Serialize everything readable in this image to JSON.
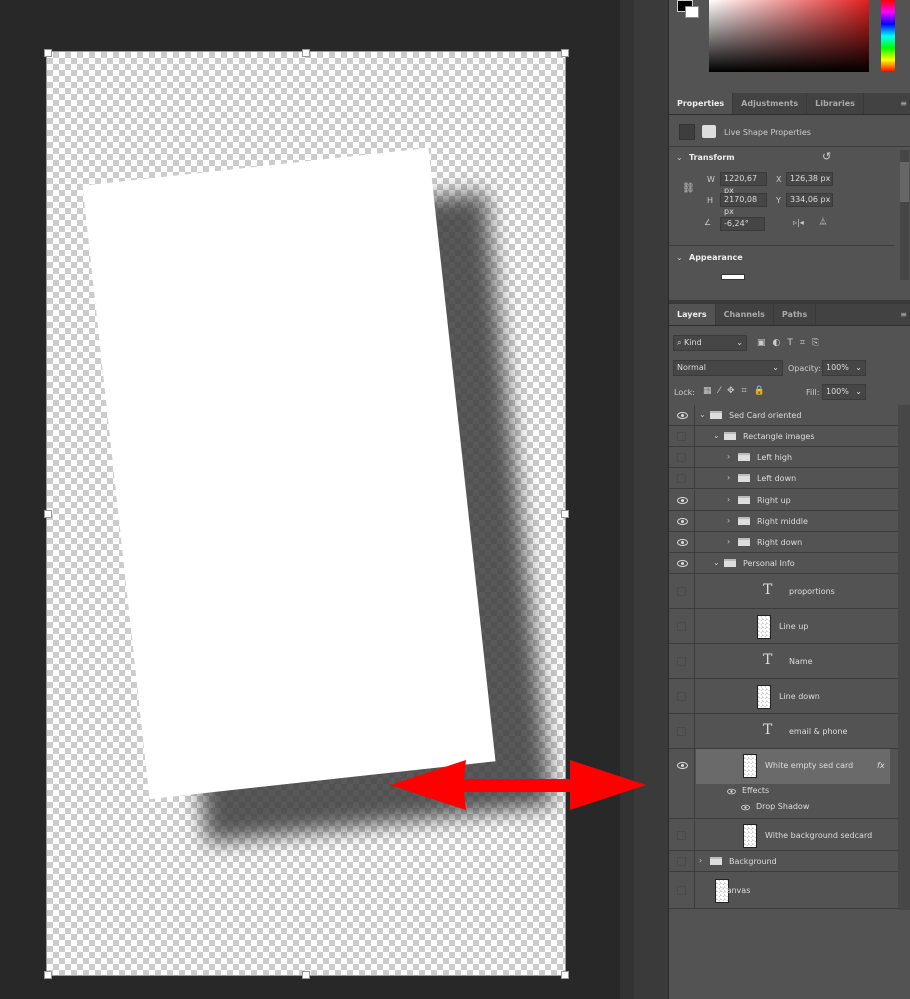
{
  "properties": {
    "tabs": [
      "Properties",
      "Adjustments",
      "Libraries"
    ],
    "subtitle": "Live Shape Properties",
    "transform_label": "Transform",
    "w_label": "W",
    "w": "1220,67 px",
    "x_label": "X",
    "x": "126,38 px",
    "h_label": "H",
    "h": "2170,08 px",
    "y_label": "Y",
    "y": "334,06 px",
    "angle": "-6,24°",
    "appearance_label": "Appearance"
  },
  "layers_panel": {
    "tabs": [
      "Layers",
      "Channels",
      "Paths"
    ],
    "filter": "Kind",
    "blend": "Normal",
    "opacity_label": "Opacity:",
    "opacity": "100%",
    "lock_label": "Lock:",
    "fill_label": "Fill:",
    "fill": "100%"
  },
  "layers": [
    {
      "name": "Sed Card oriented",
      "visible": true
    },
    {
      "name": "Rectangle images",
      "visible": false
    },
    {
      "name": "Left high",
      "visible": false
    },
    {
      "name": "Left down",
      "visible": false
    },
    {
      "name": "Right up",
      "visible": true
    },
    {
      "name": "Right middle",
      "visible": true
    },
    {
      "name": "Right down",
      "visible": true
    },
    {
      "name": "Personal Info",
      "visible": true
    },
    {
      "name": "proportions",
      "visible": false
    },
    {
      "name": "Line up",
      "visible": false
    },
    {
      "name": "Name",
      "visible": false
    },
    {
      "name": "Line down",
      "visible": false
    },
    {
      "name": "email & phone",
      "visible": false
    },
    {
      "name": "White empty sed card",
      "visible": true,
      "selected": true,
      "fx": "fx",
      "effects": "Effects",
      "drop_shadow": "Drop Shadow"
    },
    {
      "name": "Withe background sedcard",
      "visible": false
    },
    {
      "name": "Background",
      "visible": false
    },
    {
      "name": "Canvas",
      "visible": false
    }
  ],
  "colors": {
    "arrow": "#ff0000",
    "panel": "#535353",
    "workspace": "#282828"
  }
}
